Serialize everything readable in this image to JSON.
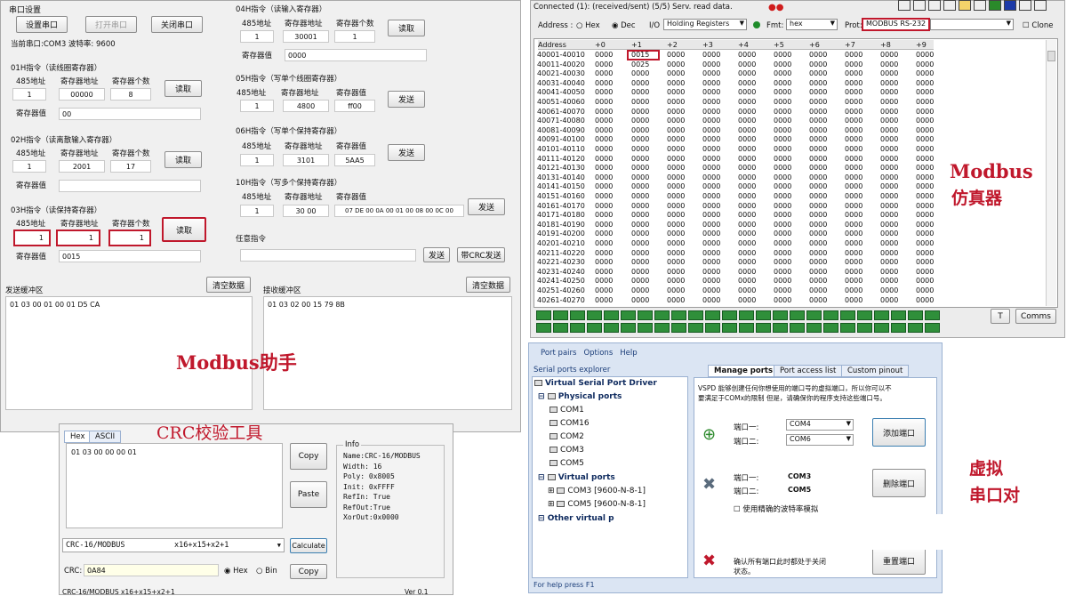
{
  "assistant": {
    "serial_title": "串口设置",
    "set_port": "设置串口",
    "open_port": "打开串口",
    "close_port": "关闭串口",
    "status": "当前串口:COM3 波特率: 9600",
    "cmd01": {
      "title": "01H指令（读线圈寄存器）",
      "h1": "485地址",
      "h2": "寄存器地址",
      "h3": "寄存器个数",
      "v1": "1",
      "v2": "00000",
      "v3": "8",
      "btn": "读取",
      "res_label": "寄存器值",
      "res": "00"
    },
    "cmd02": {
      "title": "02H指令（读离散输入寄存器）",
      "h1": "485地址",
      "h2": "寄存器地址",
      "h3": "寄存器个数",
      "v1": "1",
      "v2": "2001",
      "v3": "17",
      "btn": "读取",
      "res_label": "寄存器值",
      "res": ""
    },
    "cmd03": {
      "title": "03H指令（读保持寄存器）",
      "h1": "485地址",
      "h2": "寄存器地址",
      "h3": "寄存器个数",
      "v1": "1",
      "v2": "1",
      "v3": "1",
      "btn": "读取",
      "res_label": "寄存器值",
      "res": "0015"
    },
    "cmd04": {
      "title": "04H指令（读输入寄存器）",
      "h1": "485地址",
      "h2": "寄存器地址",
      "h3": "寄存器个数",
      "v1": "1",
      "v2": "30001",
      "v3": "1",
      "btn": "读取",
      "res_label": "寄存器值",
      "res": "0000"
    },
    "cmd05": {
      "title": "05H指令（写单个线圈寄存器）",
      "h1": "485地址",
      "h2": "寄存器地址",
      "h3": "寄存器值",
      "v1": "1",
      "v2": "4800",
      "v3": "ff00",
      "btn": "发送"
    },
    "cmd06": {
      "title": "06H指令（写单个保持寄存器）",
      "h1": "485地址",
      "h2": "寄存器地址",
      "h3": "寄存器值",
      "v1": "1",
      "v2": "3101",
      "v3": "5AA5",
      "btn": "发送"
    },
    "cmd10": {
      "title": "10H指令（写多个保持寄存器）",
      "h1": "485地址",
      "h2": "寄存器地址",
      "h3": "寄存器值",
      "v1": "1",
      "v2": "30 00",
      "v3": "07 DE  00 0A  00 01  00 08  00 0C  00",
      "btn": "发送"
    },
    "any": {
      "title": "任意指令",
      "send": "发送",
      "crc_send": "带CRC发送"
    },
    "send_buf": {
      "title": "发送缓冲区",
      "clear": "清空数据",
      "text": "01 03 00 01 00 01 D5 CA"
    },
    "recv_buf": {
      "title": "接收缓冲区",
      "clear": "清空数据",
      "text": "01 03 02 00 15 79 8B"
    },
    "caption": "Modbus助手"
  },
  "crc_tool": {
    "tab_hex": "Hex",
    "tab_ascii": "ASCII",
    "input": "01 03 00 00 00 01",
    "copy": "Copy",
    "paste": "Paste",
    "info_title": "Info",
    "info_lines": [
      "Name:CRC-16/MODBUS",
      "Width: 16",
      "Poly:  0x8005",
      "Init:  0xFFFF",
      "RefIn: True",
      "RefOut:True",
      "XorOut:0x0000"
    ],
    "algo": "CRC-16/MODBUS",
    "poly": "x16+x15+x2+1",
    "calc": "Calculate",
    "crc_label": "CRC:",
    "crc_value": "0A84",
    "hex": "Hex",
    "bin": "Bin",
    "copy2": "Copy",
    "status_left": "CRC-16/MODBUS    x16+x15+x2+1",
    "status_right": "Ver 0.1",
    "caption": "CRC校验工具"
  },
  "simulator": {
    "status": "Connected (1): (received/sent) (5/5) Serv. read data.",
    "address_label": "Address :",
    "hex": "Hex",
    "dec": "Dec",
    "io_label": "I/O",
    "io_value": "Holding Registers",
    "fmt_label": "Fmt:",
    "fmt_value": "hex",
    "prot_label": "Prot:",
    "prot_value": "MODBUS RS-232",
    "clone": "Clone",
    "columns": [
      "Address",
      "+0",
      "+1",
      "+2",
      "+3",
      "+4",
      "+5",
      "+6",
      "+7",
      "+8",
      "+9"
    ],
    "rows": [
      "40001-40010",
      "40011-40020",
      "40021-40030",
      "40031-40040",
      "40041-40050",
      "40051-40060",
      "40061-40070",
      "40071-40080",
      "40081-40090",
      "40091-40100",
      "40101-40110",
      "40111-40120",
      "40121-40130",
      "40131-40140",
      "40141-40150",
      "40151-40160",
      "40161-40170",
      "40171-40180",
      "40181-40190",
      "40191-40200",
      "40201-40210",
      "40211-40220",
      "40221-40230",
      "40231-40240",
      "40241-40250",
      "40251-40260",
      "40261-40270"
    ],
    "zero": "0000",
    "highlight": "0015",
    "second": "0025",
    "t_btn": "T",
    "comms_btn": "Comms",
    "caption1": "Modbus",
    "caption2": "仿真器"
  },
  "vspd": {
    "menu": [
      "Port pairs",
      "Options",
      "Help"
    ],
    "explorer": "Serial ports explorer",
    "tabs": [
      "Manage ports",
      "Port access list",
      "Custom pinout"
    ],
    "tree_root": "Virtual Serial Port Driver",
    "physical": "Physical ports",
    "phys_ports": [
      "COM1",
      "COM16",
      "COM2",
      "COM3",
      "COM5"
    ],
    "virtual": "Virtual ports",
    "virt_ports": [
      "COM3 [9600-N-8-1]",
      "COM5 [9600-N-8-1]"
    ],
    "other": "Other virtual p",
    "desc1": "VSPD 能够创建任何你想使用的端口号的虚拟端口，所以你可以不",
    "desc2": "要满足于COMx的限制 但是，请确保你的程序支持这些端口号。",
    "p1": "端口一:",
    "p2": "端口二:",
    "add_a": "COM4",
    "add_b": "COM6",
    "add_btn": "添加端口",
    "del_a": "COM3",
    "del_b": "COM5",
    "del_btn": "删除端口",
    "strict": "使用精确的波特率模拟",
    "reset1": "确认所有端口此时都处于关闭",
    "reset2": "状态。",
    "reset_btn": "重置端口",
    "status": "For help press F1",
    "caption1": "虚拟",
    "caption2": "串口对"
  }
}
